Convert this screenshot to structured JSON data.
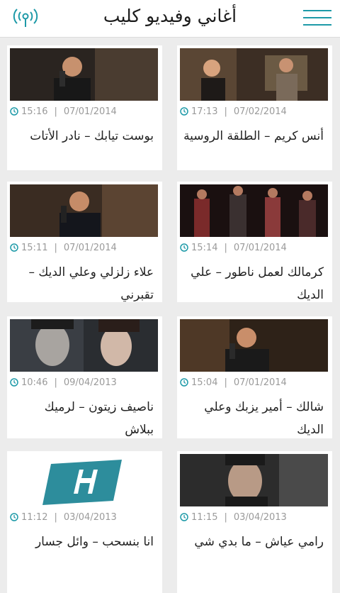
{
  "header": {
    "title": "أغاني وفيديو كليب",
    "menu_icon": "hamburger-menu-icon",
    "radio_icon": "podcast-broadcast-icon",
    "accent": "#1e9aa8"
  },
  "clips": [
    {
      "time": "17:13",
      "date": "07/02/2014",
      "title": "أنس كريم – الطلقة الروسية",
      "thumb": "studio-scene"
    },
    {
      "time": "15:16",
      "date": "07/01/2014",
      "title": "بوست تيابك – نادر الأتات",
      "thumb": "singer-mic"
    },
    {
      "time": "15:14",
      "date": "07/01/2014",
      "title": "كرمالك لعمل ناطور – علي الديك",
      "thumb": "dancing-crowd"
    },
    {
      "time": "15:11",
      "date": "07/01/2014",
      "title": "علاء زلزلي وعلي الديك – تقبرني",
      "thumb": "singer-mic"
    },
    {
      "time": "15:04",
      "date": "07/01/2014",
      "title": "شالك – أمير يزبك وعلي الديك",
      "thumb": "singer-mic"
    },
    {
      "time": "10:46",
      "date": "09/04/2013",
      "title": "ناصيف زيتون – لرميك ببلاش",
      "thumb": "couple-portrait"
    },
    {
      "time": "11:15",
      "date": "03/04/2013",
      "title": "رامي عياش – ما بدي شي",
      "thumb": "portrait"
    },
    {
      "time": "11:12",
      "date": "03/04/2013",
      "title": "انا بنسحب – وائل جسار",
      "thumb": "h-logo"
    }
  ]
}
